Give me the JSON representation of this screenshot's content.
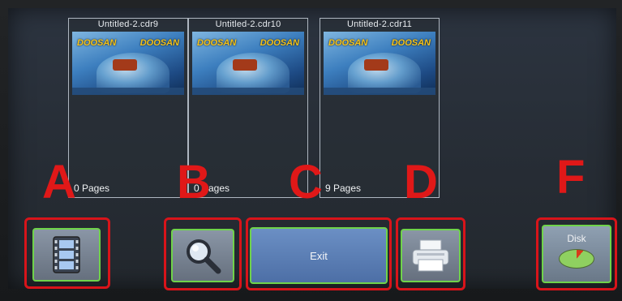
{
  "files": [
    {
      "name": "Untitled-2.cdr9",
      "pages": "0 Pages"
    },
    {
      "name": "Untitled-2.cdr10",
      "pages": "0 Pages"
    },
    {
      "name": "Untitled-2.cdr11",
      "pages": "9 Pages"
    }
  ],
  "thumbnail": {
    "brand": "DOOSAN"
  },
  "overlay_letters": {
    "a": "A",
    "b": "B",
    "c": "C",
    "d": "D",
    "f": "F"
  },
  "buttons": {
    "exit_label": "Exit",
    "disk_label": "Disk"
  },
  "icons": {
    "film": "film-icon",
    "search": "magnifier-icon",
    "print": "printer-icon",
    "disk": "disk-usage-icon"
  },
  "colors": {
    "button_border": "#6fd34a",
    "annotation_red": "#d8141a",
    "exit_button": "#5a7fb6"
  }
}
